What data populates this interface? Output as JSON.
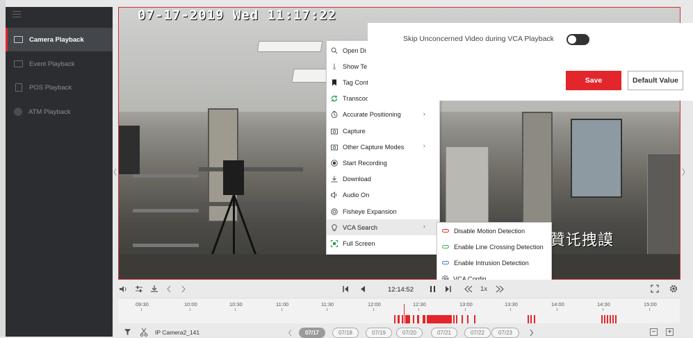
{
  "sidebar": {
    "items": [
      {
        "label": "Camera Playback",
        "active": true
      },
      {
        "label": "Event Playback",
        "active": false
      },
      {
        "label": "POS Playback",
        "active": false
      },
      {
        "label": "ATM Playback",
        "active": false
      }
    ]
  },
  "video": {
    "osd_timestamp": "07-17-2019 Wed 11:17:22",
    "osd_text": "贊讬拽謨"
  },
  "context_menu": {
    "items": [
      {
        "label": "Open Di",
        "icon": "zoom-icon",
        "submenu": false
      },
      {
        "label": "Show Te",
        "icon": "thermometer-icon",
        "submenu": false
      },
      {
        "label": "Tag Cont",
        "icon": "bookmark-icon",
        "submenu": false
      },
      {
        "label": "Transcod",
        "icon": "transcode-icon",
        "submenu": false
      },
      {
        "label": "Accurate Positioning",
        "icon": "clock-icon",
        "submenu": true
      },
      {
        "label": "Capture",
        "icon": "camera-icon",
        "submenu": false
      },
      {
        "label": "Other Capture Modes",
        "icon": "camera-icon",
        "submenu": true
      },
      {
        "label": "Start Recording",
        "icon": "record-icon",
        "submenu": false
      },
      {
        "label": "Download",
        "icon": "download-icon",
        "submenu": false
      },
      {
        "label": "Audio On",
        "icon": "speaker-icon",
        "submenu": false
      },
      {
        "label": "Fisheye Expansion",
        "icon": "fisheye-icon",
        "submenu": false
      },
      {
        "label": "VCA Search",
        "icon": "bulb-icon",
        "submenu": true
      },
      {
        "label": "Full Screen",
        "icon": "fullscreen-icon",
        "submenu": false
      }
    ]
  },
  "vca_submenu": {
    "items": [
      {
        "label": "Disable Motion Detection",
        "color": "#e3262b"
      },
      {
        "label": "Enable Line Crossing Detection",
        "color": "#37b24d"
      },
      {
        "label": "Enable Intrusion Detection",
        "color": "#2f7fd8"
      },
      {
        "label": "VCA Config",
        "color": "#555555"
      }
    ]
  },
  "settings_panel": {
    "skip_label": "Skip Unconcerned Video during VCA Playback",
    "skip_enabled": true,
    "save_label": "Save",
    "default_label": "Default Value"
  },
  "playback": {
    "time": "12:14:52",
    "speed": "1x"
  },
  "timeline": {
    "labels": [
      "09:30",
      "10:00",
      "10:30",
      "11:00",
      "11:30",
      "12:00",
      "12:30",
      "13:00",
      "13:30",
      "14:00",
      "14:30",
      "15:00"
    ]
  },
  "footer": {
    "camera_name": "IP Camera2_141",
    "dates": [
      "07/17",
      "07/18",
      "07/19",
      "07/20",
      "07/21",
      "07/22",
      "07/23"
    ],
    "selected_date": "07/17"
  },
  "colors": {
    "accent": "#e3262b",
    "sidebar_bg": "#2b2d31"
  }
}
